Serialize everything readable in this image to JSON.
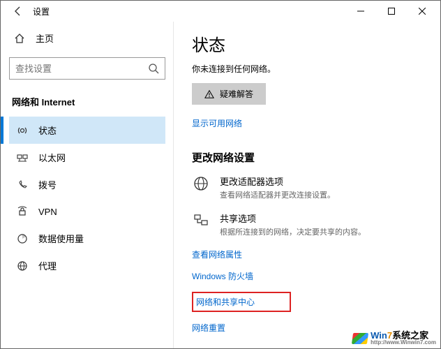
{
  "window": {
    "title": "设置"
  },
  "sidebar": {
    "home": "主页",
    "search_placeholder": "查找设置",
    "category": "网络和 Internet",
    "items": [
      {
        "label": "状态",
        "icon": "status-icon",
        "selected": true
      },
      {
        "label": "以太网",
        "icon": "ethernet-icon",
        "selected": false
      },
      {
        "label": "拨号",
        "icon": "dialup-icon",
        "selected": false
      },
      {
        "label": "VPN",
        "icon": "vpn-icon",
        "selected": false
      },
      {
        "label": "数据使用量",
        "icon": "data-usage-icon",
        "selected": false
      },
      {
        "label": "代理",
        "icon": "proxy-icon",
        "selected": false
      }
    ]
  },
  "main": {
    "title": "状态",
    "status_message": "你未连接到任何网络。",
    "troubleshoot_label": "疑难解答",
    "show_networks_link": "显示可用网络",
    "change_settings_header": "更改网络设置",
    "rows": [
      {
        "title": "更改适配器选项",
        "desc": "查看网络适配器并更改连接设置。"
      },
      {
        "title": "共享选项",
        "desc": "根据所连接到的网络，决定要共享的内容。"
      }
    ],
    "links": {
      "properties": "查看网络属性",
      "firewall": "Windows 防火墙",
      "sharing_center": "网络和共享中心",
      "reset": "网络重置"
    }
  },
  "watermark": {
    "brand_prefix": "Win",
    "brand_num": "7",
    "brand_suffix": "系统之家",
    "url": "http://www.Winwin7.com"
  }
}
